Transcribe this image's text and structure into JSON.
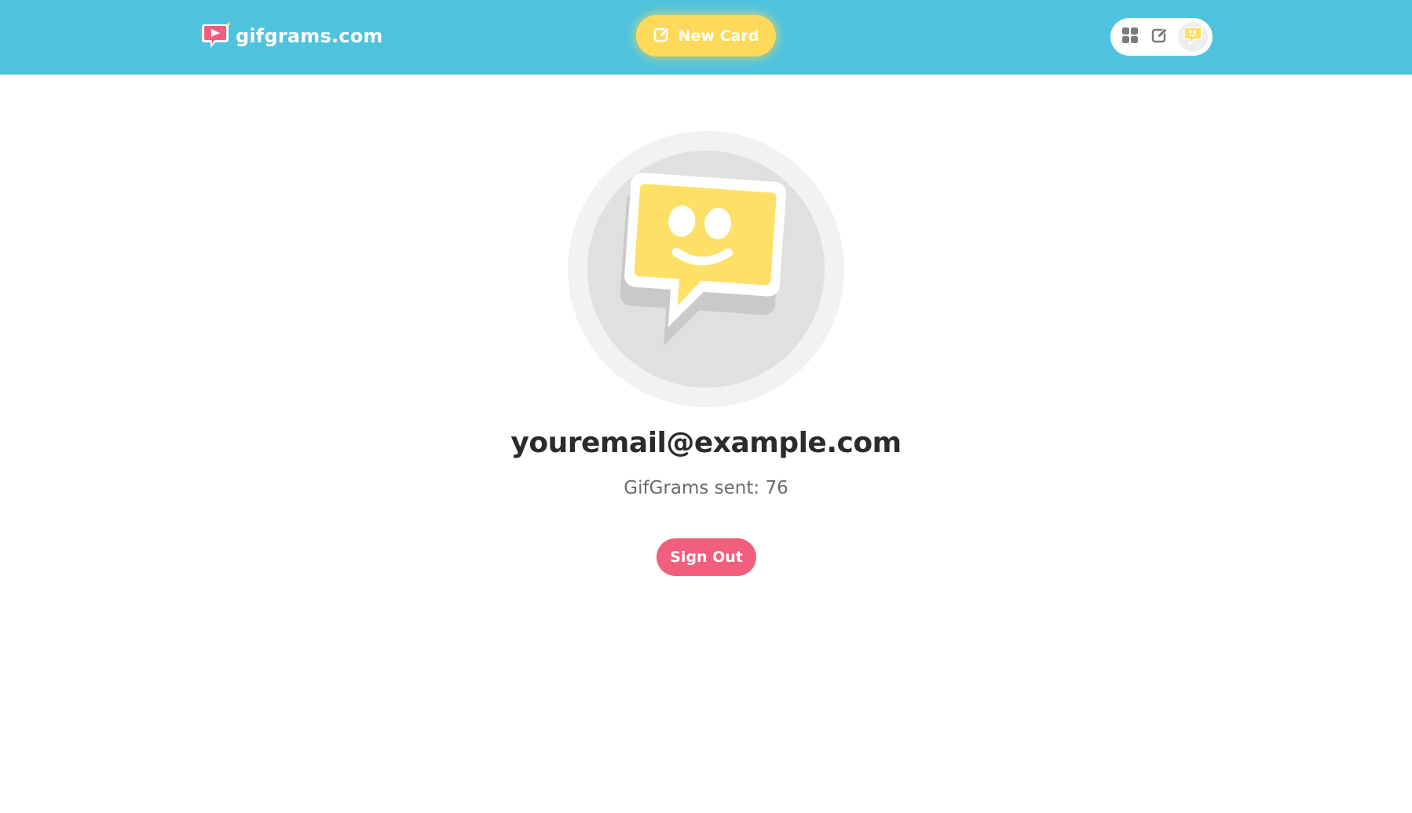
{
  "header": {
    "logo_text": "gifgrams.com",
    "new_card_label": "New Card",
    "nav_icons": [
      "grid-icon",
      "edit-icon",
      "smiley-bubble-icon"
    ]
  },
  "profile": {
    "email": "youremail@example.com",
    "sent_text": "GifGrams sent: 76",
    "avatar_icon": "smiley-speech-bubble-icon"
  },
  "actions": {
    "sign_out_label": "Sign Out"
  },
  "colors": {
    "header_bg": "#4fc3de",
    "new_card_bg": "#ffd95a",
    "sign_out_bg": "#f25f7e",
    "avatar_yellow": "#ffe066"
  }
}
